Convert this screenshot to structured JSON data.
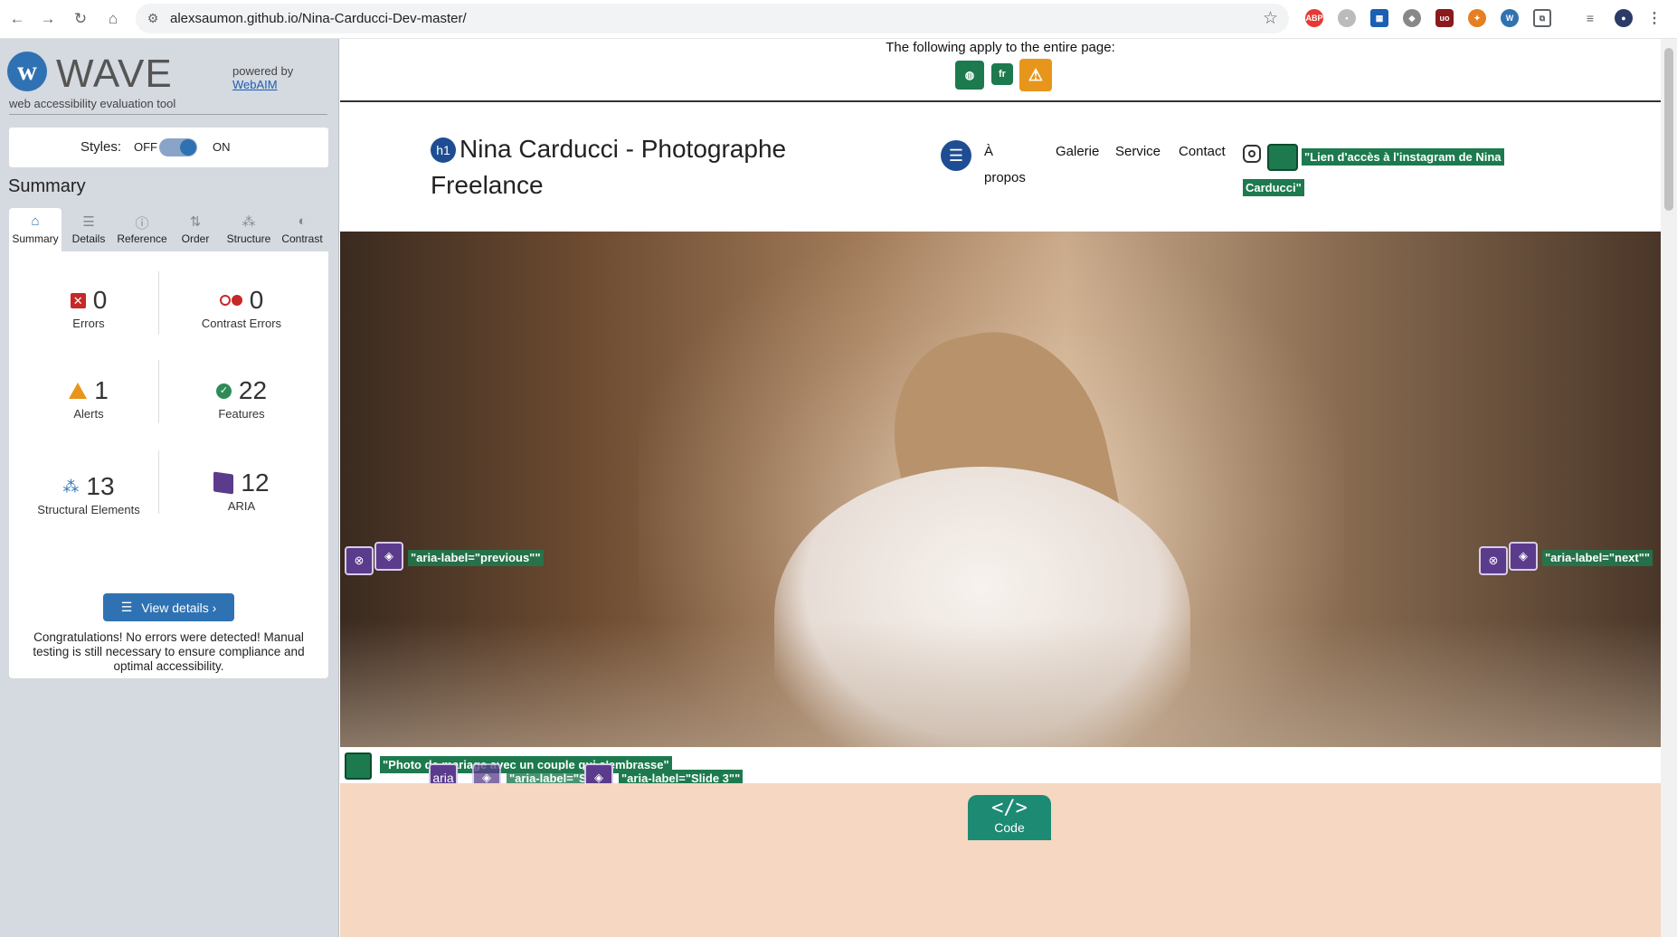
{
  "browser": {
    "url": "alexsaumon.github.io/Nina-Carducci-Dev-master/"
  },
  "wave": {
    "title": "WAVE",
    "subtitle": "web accessibility evaluation tool",
    "powered_by": "powered by",
    "webaim": "WebAIM",
    "styles_label": "Styles:",
    "styles_off": "OFF",
    "styles_on": "ON",
    "styles_enabled": true,
    "summary_title": "Summary",
    "tabs": [
      {
        "label": "Summary",
        "icon": "home-icon",
        "active": true
      },
      {
        "label": "Details",
        "icon": "list-icon"
      },
      {
        "label": "Reference",
        "icon": "info-icon"
      },
      {
        "label": "Order",
        "icon": "order-icon"
      },
      {
        "label": "Structure",
        "icon": "structure-icon"
      },
      {
        "label": "Contrast",
        "icon": "contrast-icon"
      }
    ],
    "stats": {
      "errors": {
        "value": "0",
        "label": "Errors"
      },
      "contrast_errors": {
        "value": "0",
        "label": "Contrast Errors"
      },
      "alerts": {
        "value": "1",
        "label": "Alerts"
      },
      "features": {
        "value": "22",
        "label": "Features"
      },
      "structural": {
        "value": "13",
        "label": "Structural Elements"
      },
      "aria": {
        "value": "12",
        "label": "ARIA"
      }
    },
    "view_details": "View details ›",
    "congrats": "Congratulations! No errors were detected! Manual testing is still necessary to ensure compliance and optimal accessibility."
  },
  "page": {
    "banner_text": "The following apply to the entire page:",
    "lang_badge": "fr",
    "h1_badge": "h1",
    "brand_line1": "Nina Carducci - Photographe",
    "brand_line2": "Freelance",
    "nav": {
      "apropos_line1": "À",
      "apropos_line2": "propos",
      "galerie": "Galerie",
      "service": "Service",
      "contact": "Contact"
    },
    "insta_label_line1": "\"Lien d'accès à l'instagram de Nina",
    "insta_label_line2": "Carducci\"",
    "aria_prev": "\"aria-label=\"previous\"\"",
    "aria_next": "\"aria-label=\"next\"\"",
    "photo_alt": "\"Photo de mariage avec un couple qui s'embrasse\"",
    "aria_badge": "aria",
    "aria_slide_partial": "\"aria-label=\"S",
    "aria_slide3": "\"aria-label=\"Slide 3\"\"",
    "code_symbol": "</>",
    "code_label": "Code"
  },
  "colors": {
    "wave_blue": "#2f72b3",
    "error_red": "#c62828",
    "alert_orange": "#e7961b",
    "feature_green": "#1d7a4e",
    "aria_purple": "#5b3b8c",
    "peach": "#f5d7c2"
  }
}
